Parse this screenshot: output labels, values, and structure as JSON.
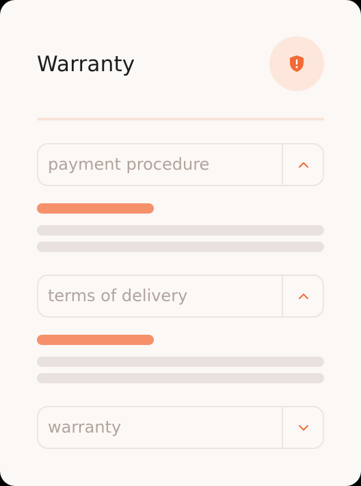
{
  "header": {
    "title": "Warranty",
    "icon": "shield-alert-icon"
  },
  "colors": {
    "accent": "#f26a36",
    "accent_soft": "#fde6db",
    "placeholder_bar": "#e8e1dd",
    "accent_bar": "#f5906a"
  },
  "sections": [
    {
      "label": "payment procedure",
      "state": "expanded",
      "icon": "chevron-up-icon"
    },
    {
      "label": "terms of delivery",
      "state": "expanded",
      "icon": "chevron-up-icon"
    },
    {
      "label": "warranty",
      "state": "collapsed",
      "icon": "chevron-down-icon"
    }
  ]
}
